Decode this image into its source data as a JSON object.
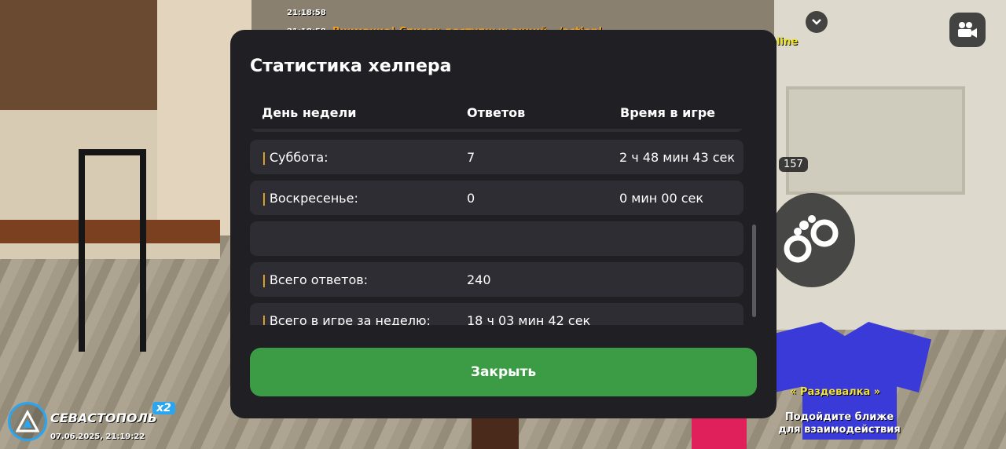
{
  "chat": {
    "lines": [
      {
        "time": "21:18:58",
        "text": ""
      },
      {
        "time": "21:18:58",
        "text": "Внимание! Список доступных акций - /action!"
      }
    ],
    "online_tag": "online"
  },
  "modal": {
    "title": "Статистика хелпера",
    "columns": [
      "День недели",
      "Ответов",
      "Время в игре"
    ],
    "rows": [
      {
        "day": "Суббота:",
        "answers": "7",
        "time": "2 ч 48 мин 43 сек"
      },
      {
        "day": "Воскресенье:",
        "answers": "0",
        "time": "0 мин 00 сек"
      },
      {
        "day": "",
        "answers": "",
        "time": ""
      },
      {
        "day": "Всего ответов:",
        "answers": "240",
        "time": ""
      },
      {
        "day": "Всего в игре за неделю:",
        "answers": "18 ч 03 мин 42 сек",
        "time": ""
      }
    ],
    "close_label": "Закрыть"
  },
  "hud": {
    "badge_count": "157",
    "area_label": "« Раздевалка »",
    "interact_hint_line1": "Подойдите ближе",
    "interact_hint_line2": "для взаимодействия",
    "city": "СЕВАСТОПОЛЬ",
    "multiplier": "x2",
    "datetime": "07.06.2025, 21:19:22"
  },
  "icons": {
    "collapse": "chevron-down-icon",
    "camera": "video-camera-icon",
    "handcuffs": "handcuffs-icon",
    "logo": "server-logo-icon"
  },
  "colors": {
    "accent_bar": "#f0b020",
    "close_button": "#3c9c46",
    "modal_bg": "#1f1f24",
    "row_bg": "#2d2d33"
  }
}
